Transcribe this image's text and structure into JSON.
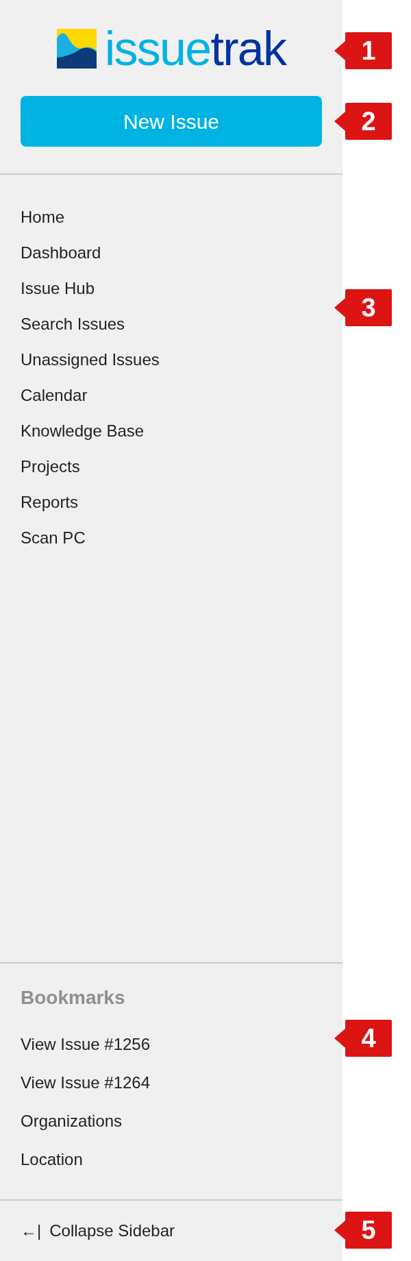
{
  "logo": {
    "primary": "issue",
    "secondary": "trak"
  },
  "new_issue_button": "New Issue",
  "nav_items": [
    "Home",
    "Dashboard",
    "Issue Hub",
    "Search Issues",
    "Unassigned Issues",
    "Calendar",
    "Knowledge Base",
    "Projects",
    "Reports",
    "Scan PC"
  ],
  "bookmarks": {
    "title": "Bookmarks",
    "items": [
      "View Issue #1256",
      "View Issue #1264",
      "Organizations",
      "Location"
    ]
  },
  "collapse": {
    "icon": "←|",
    "label": "Collapse Sidebar"
  },
  "callouts": [
    {
      "label": "1",
      "kind": "logo"
    },
    {
      "label": "2",
      "kind": "button"
    },
    {
      "label": "3",
      "kind": "nav"
    },
    {
      "label": "4",
      "kind": "bookmarks"
    },
    {
      "label": "5",
      "kind": "collapse"
    }
  ]
}
